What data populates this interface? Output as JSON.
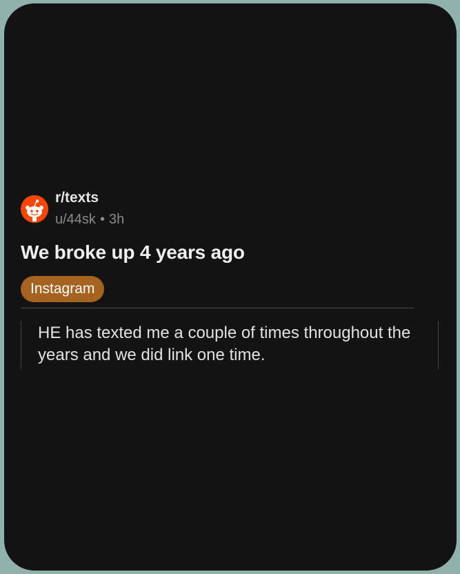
{
  "post": {
    "subreddit": "r/texts",
    "author": "u/44sk",
    "separator": "•",
    "time_ago": "3h",
    "title": "We broke up 4 years ago",
    "flair": "Instagram",
    "body": "HE has texted me a couple of times throughout the years and we did link one time."
  },
  "colors": {
    "background": "#131313",
    "flair": "#a5631f",
    "avatar": "#ff4500",
    "outer": "#8fb2ad"
  },
  "icons": {
    "avatar": "reddit-snoo-icon"
  }
}
